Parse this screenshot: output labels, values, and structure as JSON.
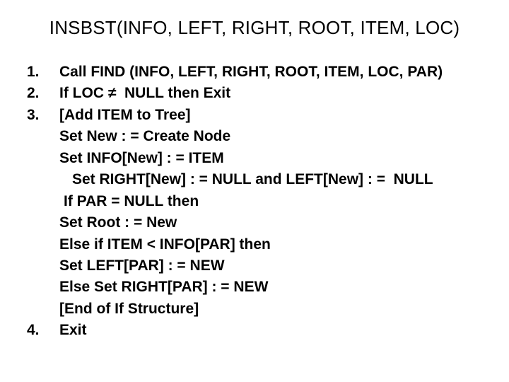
{
  "title": "INSBST(INFO, LEFT, RIGHT, ROOT, ITEM, LOC)",
  "lines": [
    {
      "num": "1.",
      "text": "Call FIND (INFO, LEFT, RIGHT, ROOT, ITEM, LOC, PAR)",
      "indent": ""
    },
    {
      "num": "2.",
      "text": "If LOC ≠  NULL then Exit",
      "indent": ""
    },
    {
      "num": "3.",
      "text": "[Add ITEM to Tree]",
      "indent": ""
    },
    {
      "num": "",
      "text": "Set New : = Create Node",
      "indent": ""
    },
    {
      "num": "",
      "text": "Set INFO[New] : = ITEM",
      "indent": ""
    },
    {
      "num": "",
      "text": "Set RIGHT[New] : = NULL and LEFT[New] : =  NULL",
      "indent": "indent1"
    },
    {
      "num": "",
      "text": "If PAR = NULL then",
      "indent": "indent2"
    },
    {
      "num": "",
      "text": "Set Root : = New",
      "indent": ""
    },
    {
      "num": "",
      "text": "Else if ITEM < INFO[PAR] then",
      "indent": ""
    },
    {
      "num": "",
      "text": "Set LEFT[PAR] : = NEW",
      "indent": ""
    },
    {
      "num": "",
      "text": "Else Set RIGHT[PAR] : = NEW",
      "indent": ""
    },
    {
      "num": "",
      "text": "[End of If Structure]",
      "indent": ""
    },
    {
      "num": "4.",
      "text": "Exit",
      "indent": ""
    }
  ]
}
